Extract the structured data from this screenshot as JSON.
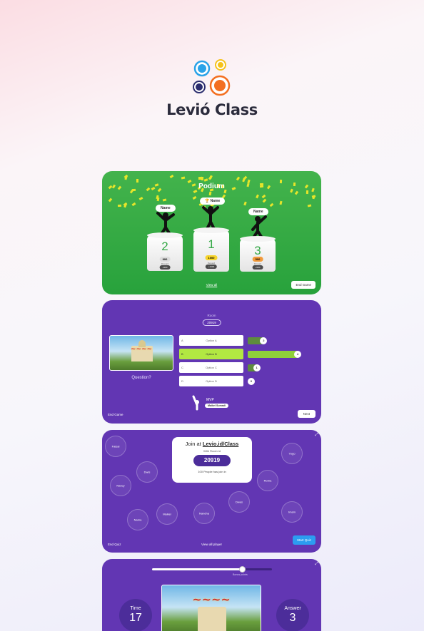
{
  "brand": {
    "name": "Levió Class"
  },
  "podium": {
    "title": "Podium",
    "view_all": "View all",
    "end_game": "End Game",
    "places": [
      {
        "rank": "2",
        "name": "Name",
        "score": "900",
        "label": "Reward",
        "coin": "+900",
        "score_color": "#dcdcdc"
      },
      {
        "rank": "1",
        "name": "Name",
        "score": "1000",
        "label": "Reward",
        "coin": "+1000",
        "score_color": "#f6d42b",
        "emoji": "🏆"
      },
      {
        "rank": "3",
        "name": "Name",
        "score": "500",
        "label": "Reward",
        "coin": "+500",
        "score_color": "#f29a3a"
      }
    ]
  },
  "quiz": {
    "room_label": "Room",
    "room_id": "20919",
    "question": "Question?",
    "options": [
      {
        "letter": "A",
        "text": "Option A",
        "count": "2",
        "bar_fraction": 0.32,
        "correct": false
      },
      {
        "letter": "B",
        "text": "Option B",
        "count": "4",
        "bar_fraction": 1.0,
        "correct": true
      },
      {
        "letter": "C",
        "text": "Option C",
        "count": "1",
        "bar_fraction": 0.18,
        "correct": false
      },
      {
        "letter": "D",
        "text": "Option D",
        "count": "0",
        "bar_fraction": 0.0,
        "correct": false
      }
    ],
    "mvp_label": "MVP",
    "mvp_name": "Maikel Sumadi",
    "end_game": "End Game",
    "next": "Next"
  },
  "lobby": {
    "join_prefix": "Join at",
    "join_url": "Levio.id/Class",
    "room_sub": "With Room id",
    "room_id": "20919",
    "joined_text": "100 People has join in",
    "players": [
      "Faisal",
      "Yugo",
      "Dwis",
      "Roma",
      "Nancy",
      "Dwes",
      "Maikel",
      "Nandha",
      "Imam",
      "Nama"
    ],
    "end_quiz": "End Quiz",
    "view_all": "View all player",
    "start_quiz": "Start Quiz"
  },
  "play": {
    "bonus_label": "Bonus points",
    "progress_fraction": 0.75,
    "time_label": "Time",
    "time_value": "17",
    "answer_label": "Answer",
    "answer_value": "3"
  },
  "colors": {
    "purple": "#6236b3",
    "green": "#39ad47",
    "accent_blue": "#2c9cf0"
  }
}
